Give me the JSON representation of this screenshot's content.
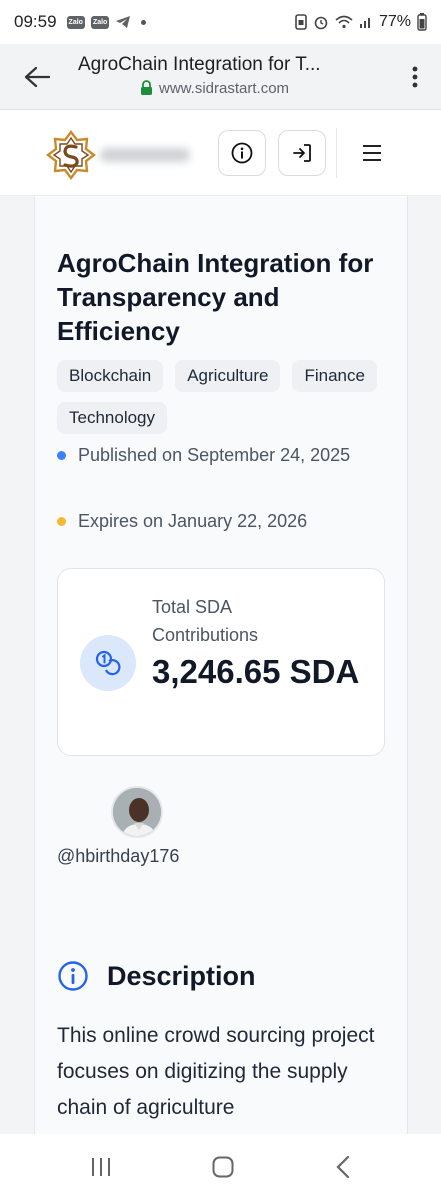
{
  "status_bar": {
    "time": "09:59",
    "badge1": "Zalo",
    "badge2": "Zalo",
    "battery": "77%"
  },
  "browser": {
    "page_title": "AgroChain Integration for T...",
    "url": "www.sidrastart.com"
  },
  "project": {
    "title": "AgroChain Integration for Transparency and Efficiency",
    "tags": [
      "Blockchain",
      "Agriculture",
      "Finance",
      "Technology"
    ],
    "published": "Published on September 24, 2025",
    "expires": "Expires on January 22, 2026",
    "stats": {
      "label": "Total SDA Contributions",
      "value": "3,246.65 SDA"
    },
    "username": "@hbirthday176",
    "description_heading": "Description",
    "description_text": "This online crowd sourcing project focuses on digitizing the supply chain of agriculture"
  },
  "colors": {
    "published_dot": "#3b82f6",
    "expires_dot": "#f5b82e",
    "accent": "#2563eb"
  }
}
